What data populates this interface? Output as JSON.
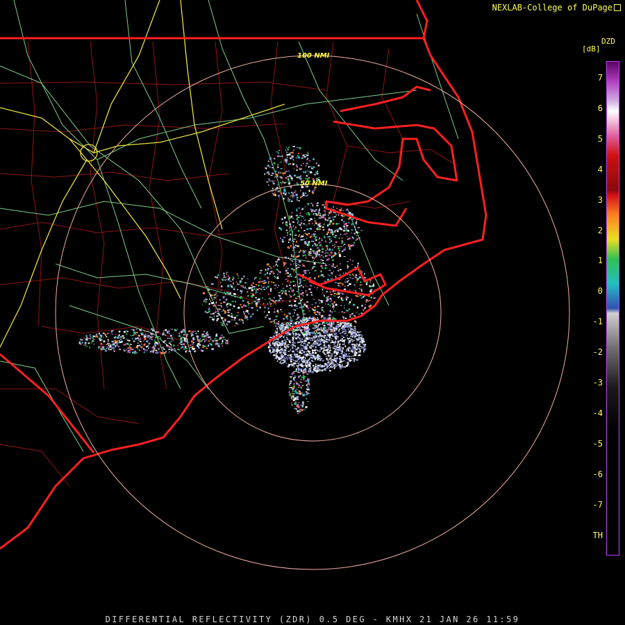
{
  "credit": "NEXLAB-College of DuPage",
  "legend": {
    "product": "DZD",
    "unit": "[dB]",
    "ticks": [
      "7",
      "6",
      "5",
      "4",
      "3",
      "2",
      "1",
      "0",
      "-1",
      "-2",
      "-3",
      "-4",
      "-5",
      "-6",
      "-7",
      "TH"
    ],
    "colors": {
      "top": "#5a0060",
      "purple": "#b040c0",
      "lavender": "#d0b0e0",
      "white": "#ffffff",
      "pink": "#e060a0",
      "red": "#d01010",
      "darkred": "#8a0a0a",
      "orange": "#ff8020",
      "yellow": "#e8e020",
      "green": "#30c050",
      "cyan": "#20c0c0",
      "blue": "#3050b0",
      "lightgray": "#d0d0d0",
      "gray": "#707070",
      "dark": "#1a1a1a",
      "black": "#000000"
    }
  },
  "rings": [
    {
      "label": "100 NMI"
    },
    {
      "label": "50 NMI"
    }
  ],
  "footer": "DIFFERENTIAL REFLECTIVITY (ZDR) 0.5 DEG - KMHX 21 JAN 26 11:59",
  "map_colors": {
    "state_border": "#ff2020",
    "county": "#b01818",
    "roads": "#7fd08a",
    "interstate": "#e8e040",
    "range_ring": "#f0b0a0"
  }
}
